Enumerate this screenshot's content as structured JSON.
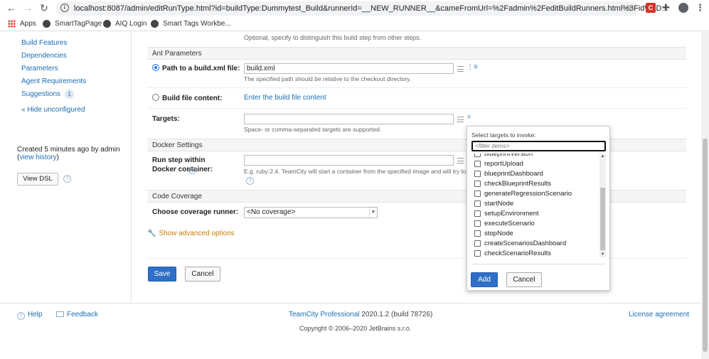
{
  "browser": {
    "url": "localhost:8087/admin/editRunType.html?id=buildType:Dummytest_Build&runnerId=__NEW_RUNNER__&cameFromUrl=%2Fadmin%2FeditBuildRunners.html%3Fid%3D...",
    "bookmarks": [
      "Apps",
      "SmartTagPage",
      "AIQ Login",
      "Smart Tags Workbe..."
    ]
  },
  "sidebar": {
    "links": [
      "Build Features",
      "Dependencies",
      "Parameters",
      "Agent Requirements",
      "Suggestions"
    ],
    "suggestions_count": "1",
    "hide_unconfigured": "« Hide unconfigured",
    "created_text": "Created 5 minutes ago by admin",
    "view_history_prefix": "(",
    "view_history": "view history",
    "view_history_suffix": ")",
    "view_dsl": "View DSL"
  },
  "form": {
    "optional_hint": "Optional, specify to distinguish this build step from other steps.",
    "ant_section": "Ant Parameters",
    "path_label": "Path to a build.xml file:",
    "path_value": "build.xml",
    "path_hint": "The specified path should be relative to the checkout directory.",
    "content_label": "Build file content:",
    "content_link": "Enter the build file content",
    "targets_label": "Targets:",
    "targets_value": "",
    "targets_hint": "Space- or comma-separated targets are supported.",
    "docker_section": "Docker Settings",
    "docker_label": "Run step within Docker container:",
    "docker_value": "",
    "docker_hint": "E.g. ruby:2.4. TeamCity will start a container from the specified image and will try to",
    "coverage_section": "Code Coverage",
    "coverage_label": "Choose coverage runner:",
    "coverage_value": "<No coverage>",
    "advanced": "Show advanced options",
    "save": "Save",
    "cancel": "Cancel"
  },
  "popup": {
    "title": "Select targets to invoke:",
    "filter_placeholder": "<filter items>",
    "items": [
      "blueprintVersion",
      "reportUpload",
      "blueprintDashboard",
      "checkBlueprintResults",
      "generateRegressionScenario",
      "startNode",
      "setupEnvironment",
      "executeScenario",
      "stopNode",
      "createScenariosDashboard",
      "checkScenarioResults"
    ],
    "add": "Add",
    "cancel": "Cancel"
  },
  "footer": {
    "help": "Help",
    "feedback": "Feedback",
    "product": "TeamCity Professional",
    "version": "2020.1.2",
    "build": "(build 78726)",
    "license": "License agreement",
    "copyright": "Copyright © 2006–2020 JetBrains s.r.o."
  },
  "colors": {
    "link": "#1a6db2",
    "primary_button": "#2f6fc7",
    "advanced_link": "#c77c02"
  }
}
